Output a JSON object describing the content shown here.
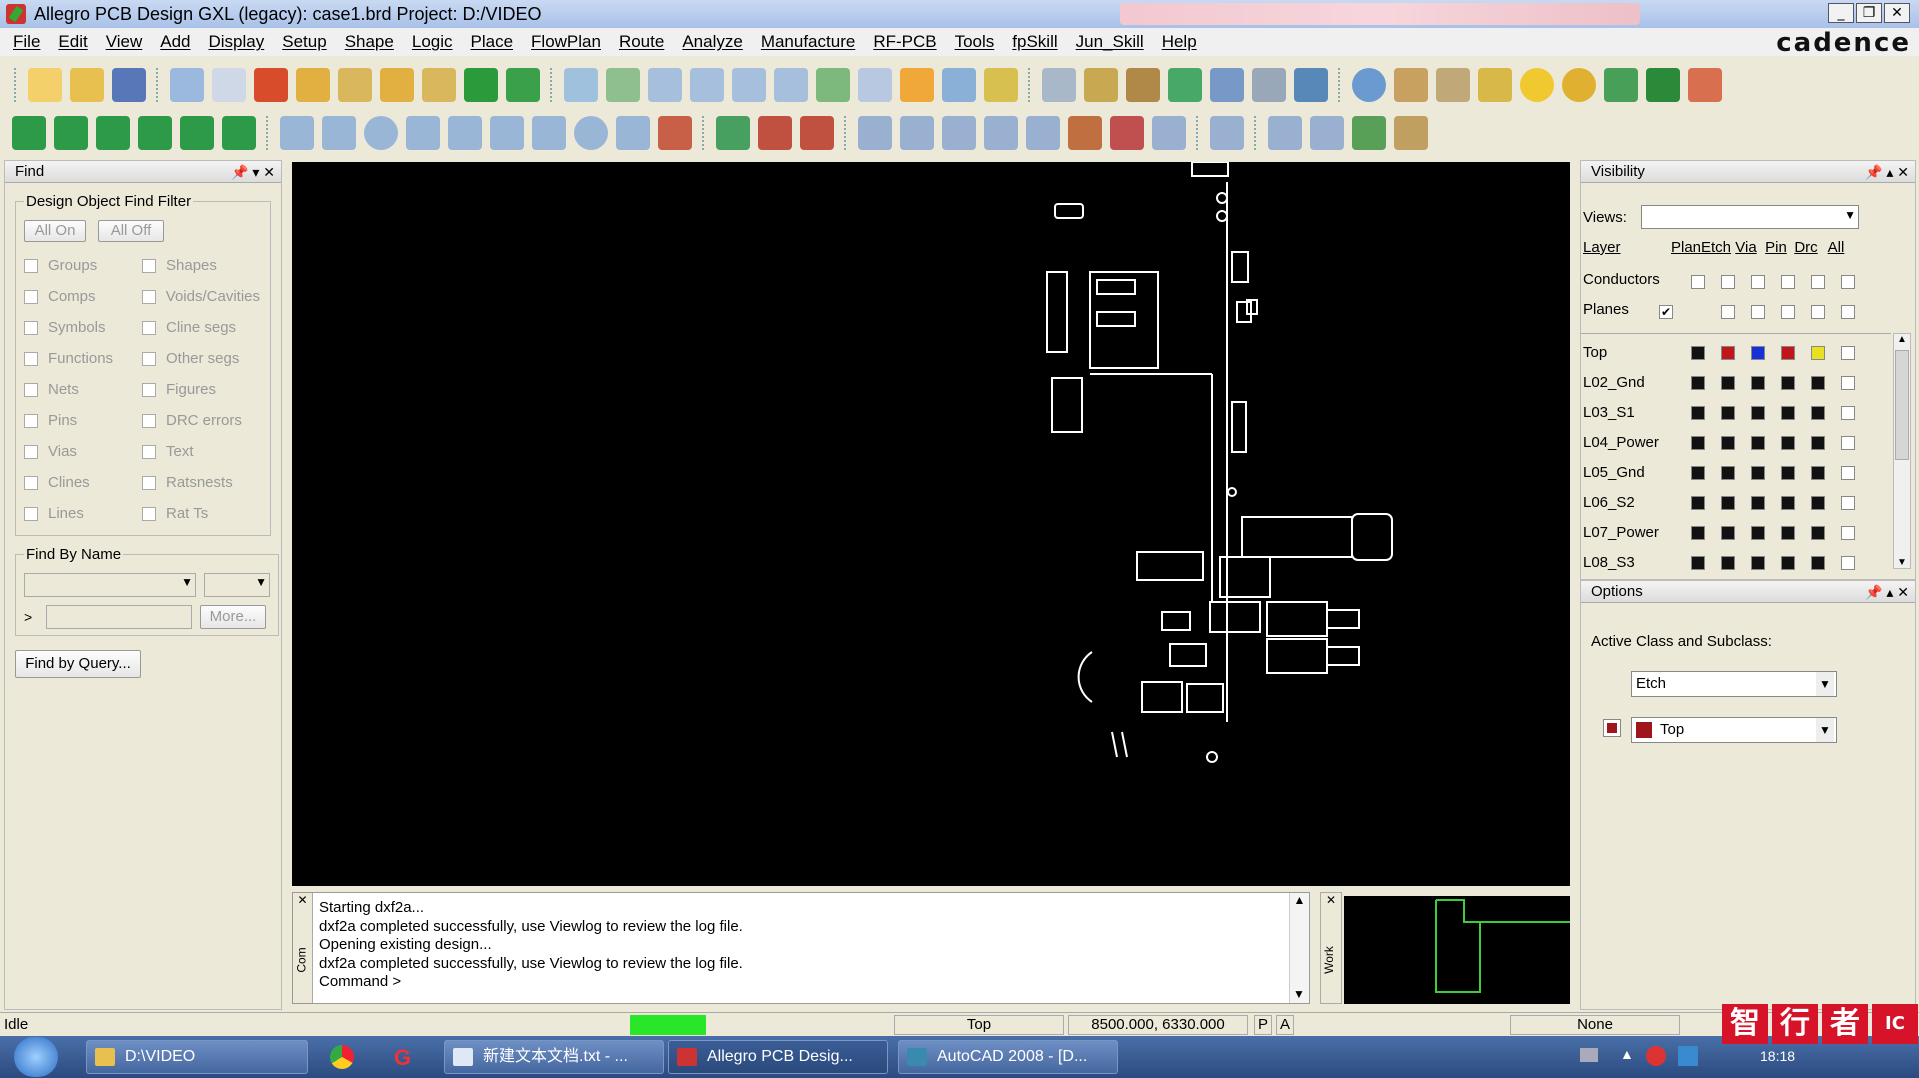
{
  "window": {
    "title": "Allegro PCB Design GXL (legacy): case1.brd  Project: D:/VIDEO",
    "minimize": "_",
    "restore": "❐",
    "close": "✕"
  },
  "menu": [
    "File",
    "Edit",
    "View",
    "Add",
    "Display",
    "Setup",
    "Shape",
    "Logic",
    "Place",
    "FlowPlan",
    "Route",
    "Analyze",
    "Manufacture",
    "RF-PCB",
    "Tools",
    "fpSkill",
    "Jun_Skill",
    "Help"
  ],
  "brand": "cadence",
  "find_panel": {
    "title": "Find",
    "filter_legend": "Design Object Find Filter",
    "all_on": "All On",
    "all_off": "All Off",
    "left_items": [
      "Groups",
      "Comps",
      "Symbols",
      "Functions",
      "Nets",
      "Pins",
      "Vias",
      "Clines",
      "Lines"
    ],
    "right_items": [
      "Shapes",
      "Voids/Cavities",
      "Cline segs",
      "Other segs",
      "Figures",
      "DRC errors",
      "Text",
      "Ratsnests",
      "Rat Ts"
    ],
    "by_name_legend": "Find By Name",
    "more": "More...",
    "query": "Find by Query...",
    "prompt": ">"
  },
  "command": {
    "lines": [
      "Starting dxf2a...",
      "dxf2a completed successfully, use Viewlog to review the log file.",
      "Opening existing design...",
      "dxf2a completed successfully, use Viewlog to review the log file.",
      "Command >"
    ],
    "side_label": "Com",
    "work_label": "Work"
  },
  "visibility": {
    "title": "Visibility",
    "views_label": "Views:",
    "views_value": "",
    "col_layer": "Layer",
    "cols": [
      "Plan",
      "Etch",
      "Via",
      "Pin",
      "Drc",
      "All"
    ],
    "conductors": "Conductors",
    "planes": "Planes",
    "planes_checked": "✔",
    "layers": [
      {
        "name": "Top",
        "colors": [
          "#111111",
          "#c0161b",
          "#1830d8",
          "#c0161b",
          "#e8e020"
        ]
      },
      {
        "name": "L02_Gnd",
        "colors": [
          "#111111",
          "#111111",
          "#111111",
          "#111111",
          "#111111"
        ]
      },
      {
        "name": "L03_S1",
        "colors": [
          "#111111",
          "#111111",
          "#111111",
          "#111111",
          "#111111"
        ]
      },
      {
        "name": "L04_Power",
        "colors": [
          "#111111",
          "#111111",
          "#111111",
          "#111111",
          "#111111"
        ]
      },
      {
        "name": "L05_Gnd",
        "colors": [
          "#111111",
          "#111111",
          "#111111",
          "#111111",
          "#111111"
        ]
      },
      {
        "name": "L06_S2",
        "colors": [
          "#111111",
          "#111111",
          "#111111",
          "#111111",
          "#111111"
        ]
      },
      {
        "name": "L07_Power",
        "colors": [
          "#111111",
          "#111111",
          "#111111",
          "#111111",
          "#111111"
        ]
      },
      {
        "name": "L08_S3",
        "colors": [
          "#111111",
          "#111111",
          "#111111",
          "#111111",
          "#111111"
        ]
      }
    ]
  },
  "options": {
    "title": "Options",
    "active_label": "Active Class and Subclass:",
    "class_value": "Etch",
    "subclass_value": "Top",
    "subclass_color": "#a0141b"
  },
  "status": {
    "state": "Idle",
    "layer": "Top",
    "coords": "8500.000, 6330.000",
    "p": "P",
    "a": "A",
    "mode": "None"
  },
  "taskbar": {
    "items": [
      "D:\\VIDEO",
      "新建文本文档.txt - ...",
      "Allegro PCB Desig...",
      "AutoCAD 2008 - [D..."
    ],
    "time": "18:18"
  },
  "watermark": [
    "智",
    "行",
    "者",
    "IC"
  ]
}
